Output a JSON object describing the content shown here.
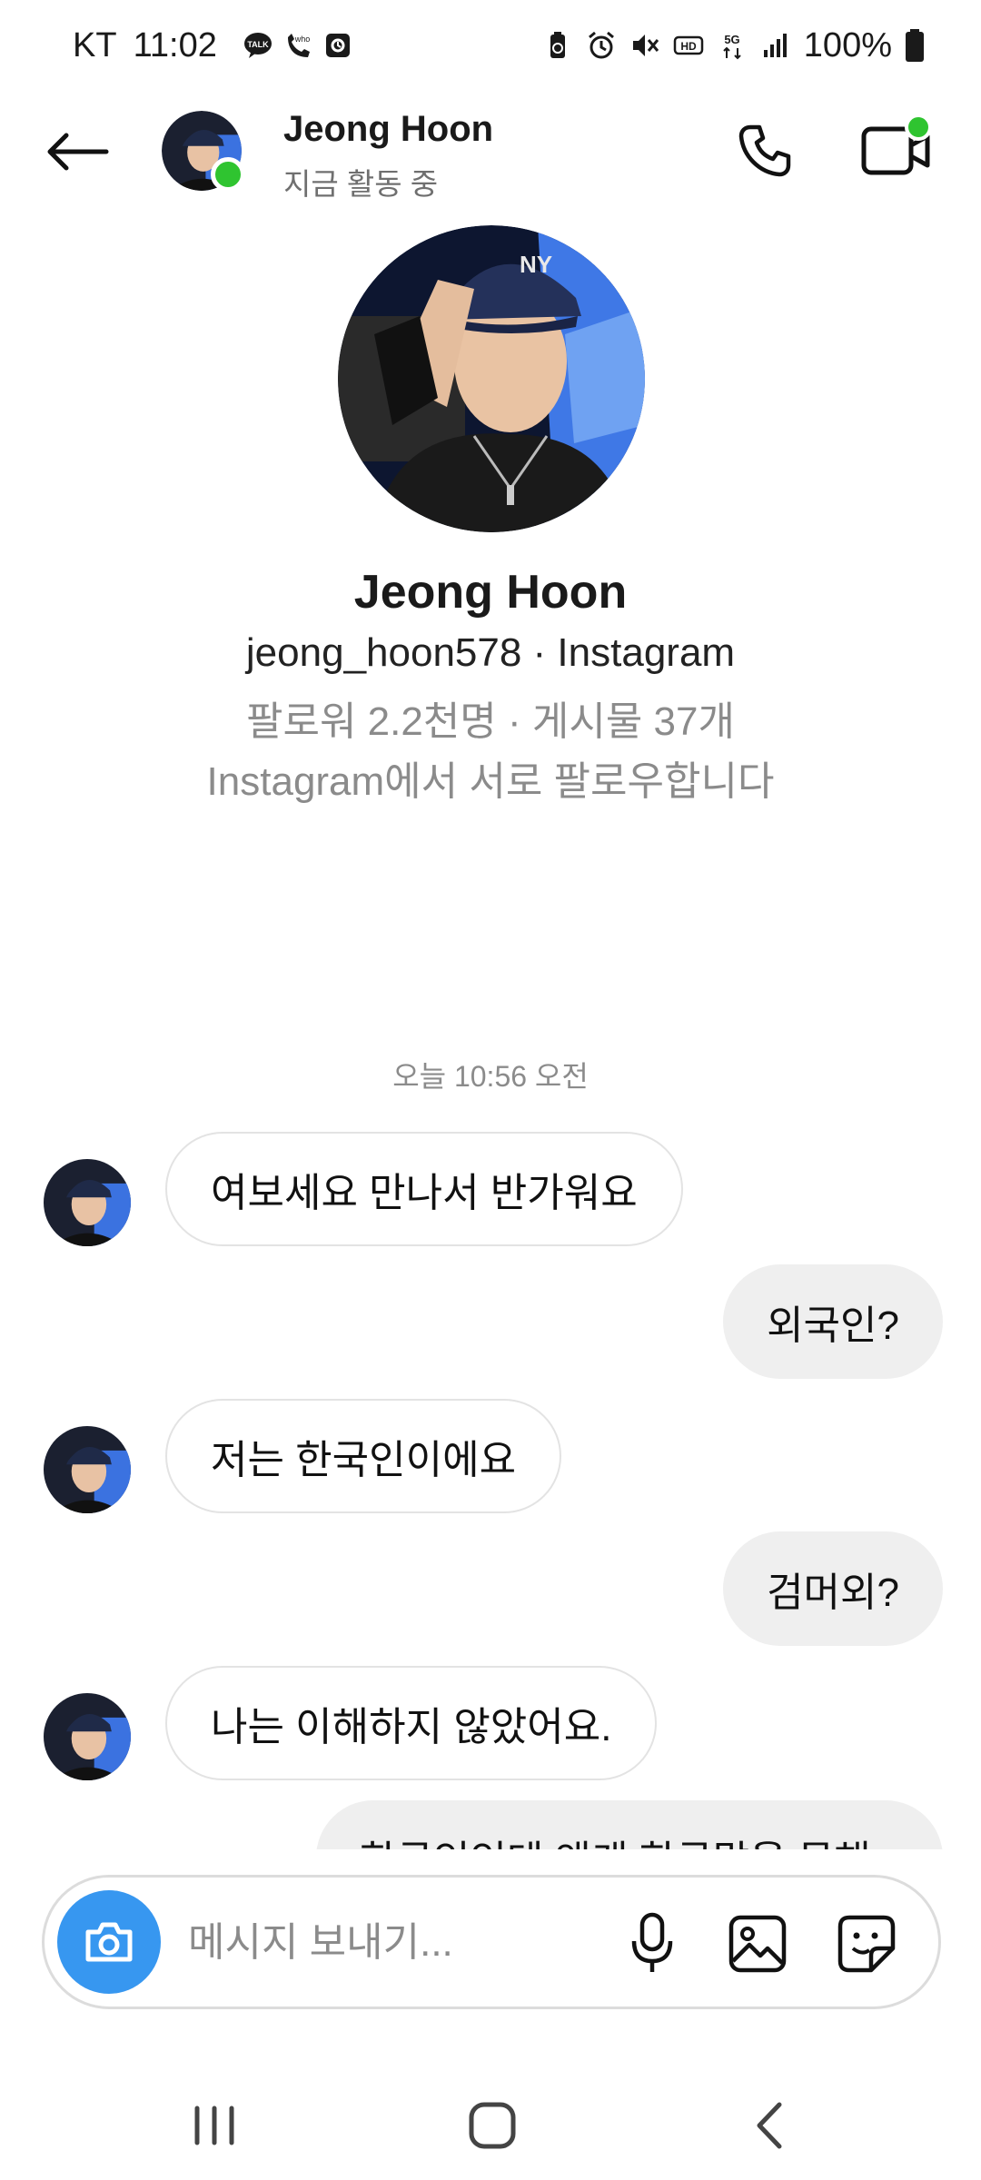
{
  "status_bar": {
    "carrier": "KT",
    "time": "11:02",
    "notification_icons": [
      "talk-icon",
      "whowho-icon",
      "app-notification-icon"
    ],
    "system_icons": [
      "battery-saver-icon",
      "alarm-icon",
      "mute-icon",
      "hd-voice-icon",
      "5g-icon",
      "signal-icon"
    ],
    "battery": "100%"
  },
  "header": {
    "name": "Jeong Hoon",
    "status": "지금 활동 중",
    "online_color": "#2fc430"
  },
  "profile": {
    "name": "Jeong Hoon",
    "handle": "jeong_hoon578 · Instagram",
    "stats": "팔로워 2.2천명 · 게시물 37개",
    "mutual": "Instagram에서 서로 팔로우합니다"
  },
  "thread": {
    "timestamp": "오늘 10:56 오전",
    "messages": [
      {
        "from": "them",
        "text": "여보세요 만나서 반가워요"
      },
      {
        "from": "me",
        "text": "외국인?"
      },
      {
        "from": "them",
        "text": "저는 한국인이에요"
      },
      {
        "from": "me",
        "text": "검머외?"
      },
      {
        "from": "them",
        "text": "나는 이해하지 않았어요."
      },
      {
        "from": "me",
        "text": "한국인인데 왜케 한국말을 못해"
      }
    ]
  },
  "composer": {
    "placeholder": "메시지 보내기...",
    "accent_color": "#3797f0"
  },
  "navbar": {
    "buttons": [
      "recent-apps",
      "home",
      "back"
    ]
  }
}
